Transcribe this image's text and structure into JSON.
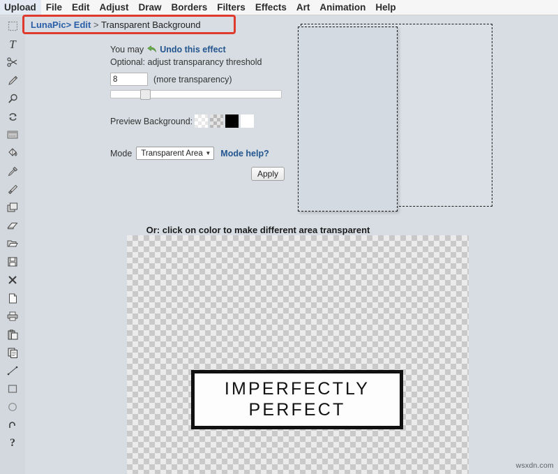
{
  "menubar": {
    "items": [
      {
        "label": "Upload",
        "name": "menu-upload"
      },
      {
        "label": "File",
        "name": "menu-file"
      },
      {
        "label": "Edit",
        "name": "menu-edit"
      },
      {
        "label": "Adjust",
        "name": "menu-adjust"
      },
      {
        "label": "Draw",
        "name": "menu-draw"
      },
      {
        "label": "Borders",
        "name": "menu-borders"
      },
      {
        "label": "Filters",
        "name": "menu-filters"
      },
      {
        "label": "Effects",
        "name": "menu-effects"
      },
      {
        "label": "Art",
        "name": "menu-art"
      },
      {
        "label": "Animation",
        "name": "menu-animation"
      },
      {
        "label": "Help",
        "name": "menu-help"
      }
    ]
  },
  "sidebar": {
    "tools": [
      {
        "icon": "marquee-select-icon"
      },
      {
        "icon": "text-tool-icon"
      },
      {
        "icon": "scissors-icon"
      },
      {
        "icon": "pencil-icon"
      },
      {
        "icon": "magnifier-icon"
      },
      {
        "icon": "rotate-icon"
      },
      {
        "icon": "crop-icon"
      },
      {
        "icon": "paint-bucket-icon"
      },
      {
        "icon": "eyedropper-icon"
      },
      {
        "icon": "paintbrush-icon"
      },
      {
        "icon": "layers-icon"
      },
      {
        "icon": "eraser-icon"
      },
      {
        "icon": "open-folder-icon"
      },
      {
        "icon": "save-disk-icon"
      },
      {
        "icon": "close-x-icon"
      },
      {
        "icon": "new-file-icon"
      },
      {
        "icon": "print-icon"
      },
      {
        "icon": "paste-icon"
      },
      {
        "icon": "copy-icon"
      },
      {
        "icon": "line-tool-icon"
      },
      {
        "icon": "rectangle-tool-icon"
      },
      {
        "icon": "ellipse-tool-icon"
      },
      {
        "icon": "undo-arrow-icon"
      },
      {
        "icon": "help-question-icon"
      }
    ]
  },
  "breadcrumb": {
    "root": "LunaPic",
    "separator": ">",
    "section": "Edit",
    "separator2": ">",
    "page": "Transparent Background",
    "highlight_color": "#e03a2f"
  },
  "controls": {
    "undo_prefix": "You may",
    "undo_link": "Undo this effect",
    "undo_icon": "undo-arrow-icon",
    "optional_text": "Optional: adjust transparancy threshold",
    "threshold_value": "8",
    "threshold_hint": "(more transparency)",
    "slider_position_percent": 18,
    "preview_bg_label": "Preview Background:",
    "preview_bg_swatches": [
      {
        "name": "swatch-checker-light",
        "type": "checker-light"
      },
      {
        "name": "swatch-checker-dark",
        "type": "checker-dark"
      },
      {
        "name": "swatch-black",
        "color": "#000000"
      },
      {
        "name": "swatch-white",
        "color": "#ffffff"
      }
    ],
    "mode_label": "Mode",
    "mode_value": "Transparent Area",
    "mode_options": [
      "Transparent Area"
    ],
    "mode_caret": "▼",
    "mode_help_link": "Mode help?",
    "apply_label": "Apply"
  },
  "canvas": {
    "hint": "Or: click on color to make different area transparent",
    "sign_line1": "IMPERFECTLY",
    "sign_line2": "PERFECT"
  },
  "watermark": {
    "text": "wsxdn.com"
  }
}
